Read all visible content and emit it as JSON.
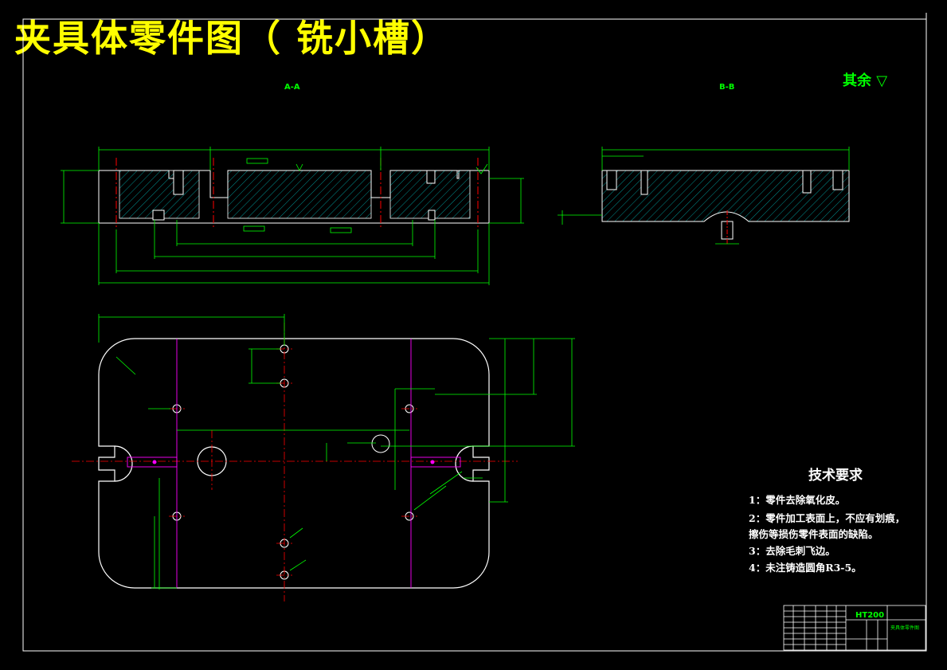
{
  "title": "夹具体零件图（  铣小槽）",
  "roughness_note": "其余",
  "section_labels": {
    "a": "A-A",
    "b": "B-B"
  },
  "technical_requirements": {
    "heading": "技术要求",
    "items": [
      "1：零件去除氧化皮。",
      "2：零件加工表面上，不应有划痕，",
      "     擦伤等损伤零件表面的缺陷。",
      "3：去除毛刺飞边。",
      "4：未注铸造圆角R3-5。"
    ]
  },
  "title_block": {
    "material": "HT200",
    "part_name": "夹具体零件图"
  },
  "colors": {
    "outline": "#ffffff",
    "dimension": "#00ff00",
    "centerline": "#ff0000",
    "axis": "#ff00ff",
    "title": "#ffff00"
  }
}
